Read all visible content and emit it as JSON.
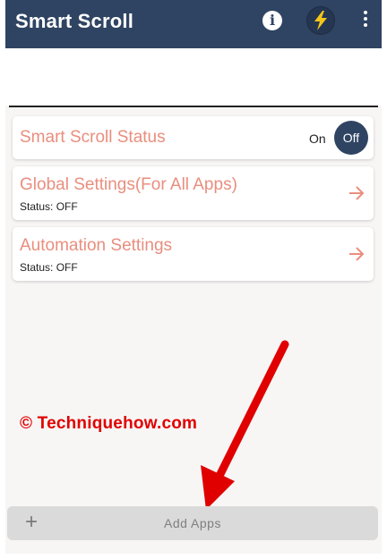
{
  "app": {
    "title": "Smart Scroll",
    "colors": {
      "appbar": "#2f4462",
      "accent_text": "#e98e7e",
      "background": "#f7f6f5",
      "watermark": "#e10000",
      "annotation_arrow": "#e00000"
    }
  },
  "toolbar": {
    "info_glyph": "i",
    "info_icon": "info-icon",
    "power_icon": "lightning-bolt-icon",
    "more_icon": "more-vert-icon"
  },
  "cards": {
    "status": {
      "title": "Smart Scroll Status",
      "on_label": "On",
      "off_label": "Off"
    },
    "global": {
      "title": "Global Settings(For All Apps)",
      "status": "Status: OFF",
      "icon": "arrow-right-icon"
    },
    "automation": {
      "title": "Automation Settings",
      "status": "Status: OFF",
      "icon": "arrow-right-icon"
    }
  },
  "watermark": {
    "text": "© Techniquehow.com"
  },
  "bottom_bar": {
    "plus": "+",
    "label": "Add Apps"
  }
}
